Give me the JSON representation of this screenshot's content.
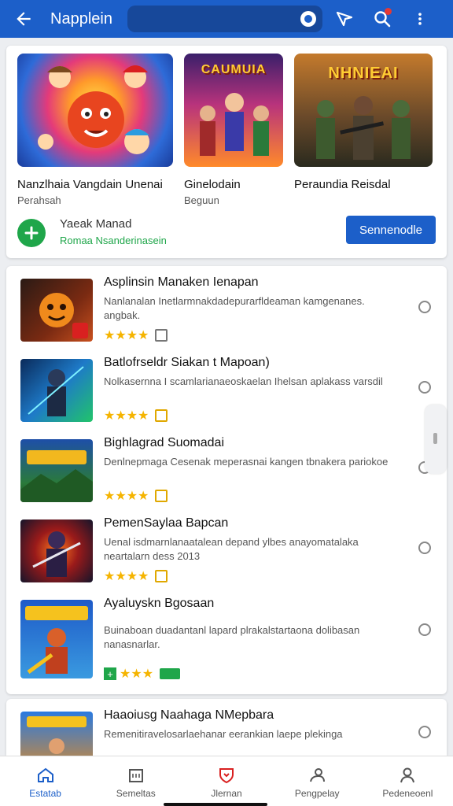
{
  "app_bar": {
    "title": "Napplein",
    "search_value": "",
    "icons": [
      "back-arrow-icon",
      "mic-icon",
      "send-icon",
      "search-icon",
      "more-vert-icon"
    ]
  },
  "featured": {
    "games": [
      {
        "name": "Nanzlhaia Vangdain Unenai",
        "subtitle": "Perahsah",
        "art_title": ""
      },
      {
        "name": "Ginelodain",
        "subtitle": "Beguun",
        "art_title": "CAUMUIA"
      },
      {
        "name": "Peraundia Reisdal",
        "subtitle": "",
        "art_title": "NHNIEAI"
      }
    ],
    "promo": {
      "title": "Yaeak  Manad",
      "subtitle": "Romaa Nsanderinasein",
      "button": "Sennenodle"
    }
  },
  "apps": [
    {
      "name": "Asplinsin Manaken Ienapan",
      "desc": "Nanlanalan Inetlarmnakdadepurarfldeaman kamgenanes. angbak.",
      "stars": "★★★★",
      "badge": "gray"
    },
    {
      "name": "Batlofrseldr Siakan t Mapoan)",
      "desc": "Nolkasernna I scamlarianaeoskaelan Ihelsan aplakass varsdil",
      "stars": "★★★★",
      "badge": "yellow"
    },
    {
      "name": "Bighlagrad Suomadai",
      "desc": "Denlnepmaga Cesenak meperasnai kangen tbnakera pariokoe",
      "stars": "★★★★",
      "badge": "yellow"
    },
    {
      "name": "PemenSaylaa Bapcan",
      "desc": "Uenal isdmarnlanaatalean depand ylbes anayomatalaka neartalarn dess 2013",
      "stars": "★★★★",
      "badge": "yellow"
    },
    {
      "name": "Ayaluyskn Bgosaan",
      "desc": "Buinaboan duadantanl lapard plrakalstartaona dolibasan nanasnarlar.",
      "stars": "★★★",
      "badge": "green"
    },
    {
      "name": "Haaoiusg Naahaga NMepbara",
      "desc": "Remenitiravelosarlaehanar eerankian laepe plekinga",
      "stars": "",
      "badge": ""
    }
  ],
  "bottom_nav": [
    {
      "label": "Estatab",
      "icon": "home-icon",
      "active": true
    },
    {
      "label": "Semeltas",
      "icon": "store-icon",
      "active": false
    },
    {
      "label": "Jlernan",
      "icon": "shield-icon",
      "active": false
    },
    {
      "label": "Pengpelay",
      "icon": "people-icon",
      "active": false
    },
    {
      "label": "Pedeneoenl",
      "icon": "person-icon",
      "active": false
    }
  ],
  "colors": {
    "primary": "#1c5fc9",
    "accent_green": "#1fa64a",
    "star": "#f5b400",
    "badge_red": "#e53935"
  }
}
